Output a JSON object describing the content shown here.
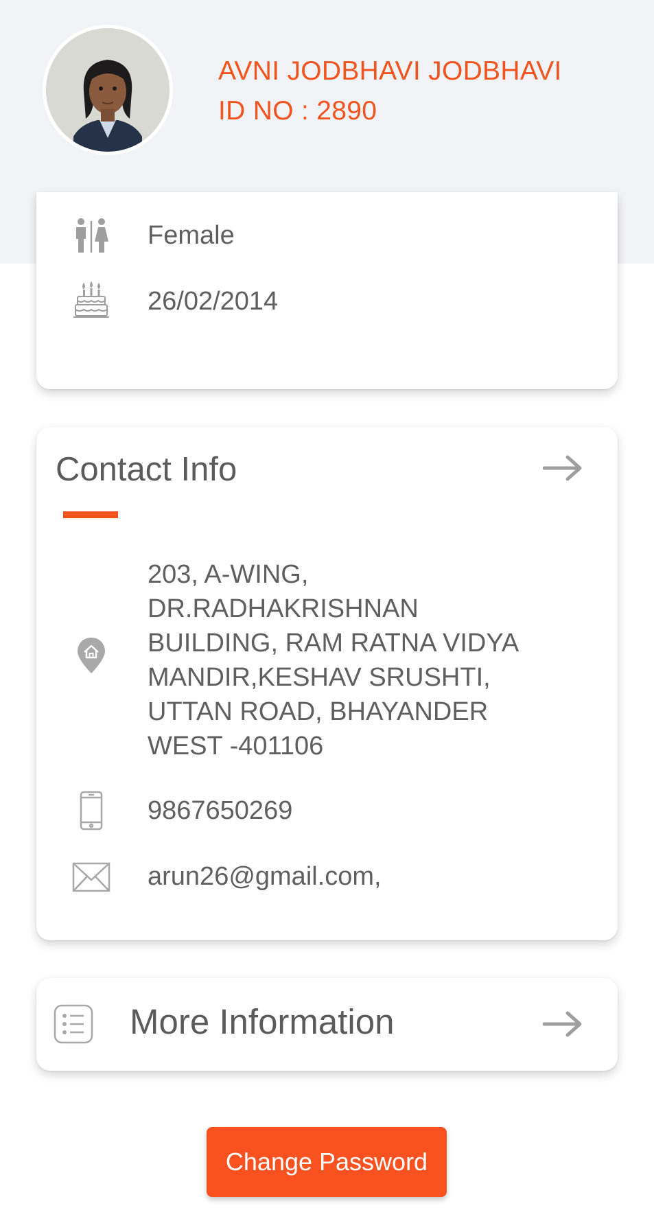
{
  "profile": {
    "name": "AVNI JODBHAVI JODBHAVI",
    "id_text": "ID NO : 2890",
    "avatar_icon": "student-photo"
  },
  "personal": {
    "gender": "Female",
    "gender_icon": "gender-icon",
    "dob": "26/02/2014",
    "dob_icon": "birthday-cake-icon"
  },
  "contact": {
    "title": "Contact Info",
    "address_lines": [
      "203, A-WING,",
      "DR.RADHAKRISHNAN",
      "BUILDING, RAM RATNA VIDYA",
      "MANDIR,KESHAV SRUSHTI,",
      "UTTAN ROAD, BHAYANDER",
      "WEST -401106"
    ],
    "address_icon": "home-location-pin-icon",
    "phone": "9867650269",
    "phone_icon": "mobile-phone-icon",
    "email": "arun26@gmail.com,",
    "email_icon": "envelope-icon"
  },
  "more": {
    "title": "More Information",
    "icon": "list-icon"
  },
  "actions": {
    "change_password": "Change Password"
  },
  "colors": {
    "accent": "#f0541f",
    "button": "#fa5120",
    "header_bg": "#f2f3f7",
    "text": "#5f5f5f",
    "icon": "#9e9e9e"
  }
}
